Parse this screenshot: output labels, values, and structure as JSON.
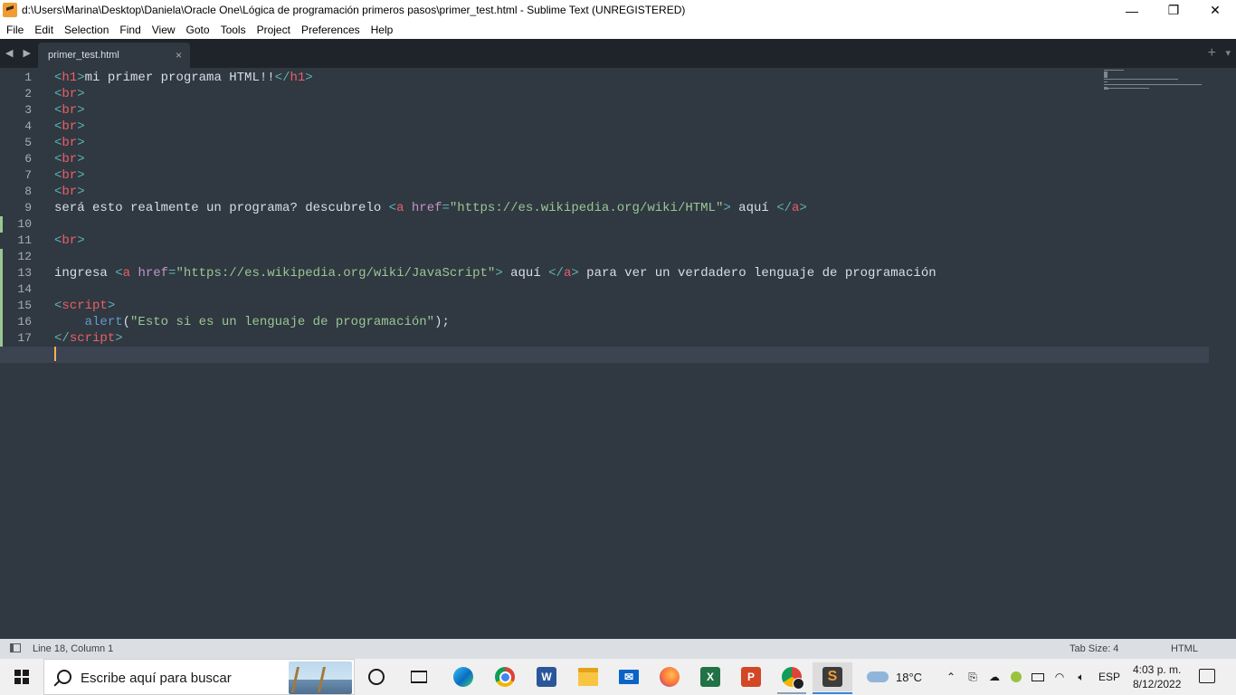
{
  "window": {
    "title": "d:\\Users\\Marina\\Desktop\\Daniela\\Oracle One\\Lógica de programación primeros pasos\\primer_test.html - Sublime Text (UNREGISTERED)",
    "minimize_glyph": "—",
    "maximize_glyph": "❐",
    "close_glyph": "✕"
  },
  "menu": [
    "File",
    "Edit",
    "Selection",
    "Find",
    "View",
    "Goto",
    "Tools",
    "Project",
    "Preferences",
    "Help"
  ],
  "tabs": {
    "nav_arrows": "◀ ▶",
    "active_tab": "primer_test.html",
    "close_glyph": "×",
    "add_glyph": "+",
    "more_glyph": "▾"
  },
  "editor": {
    "active_line": 18,
    "modified_lines": [
      10,
      12,
      13,
      14,
      15,
      16,
      17,
      18
    ],
    "lines": [
      [
        [
          "pn",
          "<"
        ],
        [
          "tg",
          "h1"
        ],
        [
          "pn",
          ">"
        ],
        [
          "tx",
          "mi primer programa HTML!!"
        ],
        [
          "pn",
          "</"
        ],
        [
          "tg",
          "h1"
        ],
        [
          "pn",
          ">"
        ]
      ],
      [
        [
          "pn",
          "<"
        ],
        [
          "tg",
          "br"
        ],
        [
          "pn",
          ">"
        ]
      ],
      [
        [
          "pn",
          "<"
        ],
        [
          "tg",
          "br"
        ],
        [
          "pn",
          ">"
        ]
      ],
      [
        [
          "pn",
          "<"
        ],
        [
          "tg",
          "br"
        ],
        [
          "pn",
          ">"
        ]
      ],
      [
        [
          "pn",
          "<"
        ],
        [
          "tg",
          "br"
        ],
        [
          "pn",
          ">"
        ]
      ],
      [
        [
          "pn",
          "<"
        ],
        [
          "tg",
          "br"
        ],
        [
          "pn",
          ">"
        ]
      ],
      [
        [
          "pn",
          "<"
        ],
        [
          "tg",
          "br"
        ],
        [
          "pn",
          ">"
        ]
      ],
      [
        [
          "pn",
          "<"
        ],
        [
          "tg",
          "br"
        ],
        [
          "pn",
          ">"
        ]
      ],
      [
        [
          "tx",
          "será esto realmente un programa? descubrelo "
        ],
        [
          "pn",
          "<"
        ],
        [
          "tg",
          "a"
        ],
        [
          "tx",
          " "
        ],
        [
          "at",
          "href"
        ],
        [
          "pn",
          "="
        ],
        [
          "st",
          "\"https://es.wikipedia.org/wiki/HTML\""
        ],
        [
          "pn",
          ">"
        ],
        [
          "tx",
          " aquí "
        ],
        [
          "pn",
          "</"
        ],
        [
          "tg",
          "a"
        ],
        [
          "pn",
          ">"
        ]
      ],
      [],
      [
        [
          "pn",
          "<"
        ],
        [
          "tg",
          "br"
        ],
        [
          "pn",
          ">"
        ]
      ],
      [],
      [
        [
          "tx",
          "ingresa "
        ],
        [
          "pn",
          "<"
        ],
        [
          "tg",
          "a"
        ],
        [
          "tx",
          " "
        ],
        [
          "at",
          "href"
        ],
        [
          "pn",
          "="
        ],
        [
          "st",
          "\"https://es.wikipedia.org/wiki/JavaScript\""
        ],
        [
          "pn",
          ">"
        ],
        [
          "tx",
          " aquí "
        ],
        [
          "pn",
          "</"
        ],
        [
          "tg",
          "a"
        ],
        [
          "pn",
          ">"
        ],
        [
          "tx",
          " para ver un verdadero lenguaje de programación"
        ]
      ],
      [],
      [
        [
          "pn",
          "<"
        ],
        [
          "tg",
          "script"
        ],
        [
          "pn",
          ">"
        ]
      ],
      [
        [
          "tx",
          "    "
        ],
        [
          "fn",
          "alert"
        ],
        [
          "tx",
          "("
        ],
        [
          "st",
          "\"Esto si es un lenguaje de programación\""
        ],
        [
          "tx",
          ");"
        ]
      ],
      [
        [
          "pn",
          "</"
        ],
        [
          "tg",
          "script"
        ],
        [
          "pn",
          ">"
        ]
      ],
      []
    ]
  },
  "status": {
    "position": "Line 18, Column 1",
    "tab_size": "Tab Size: 4",
    "syntax": "HTML"
  },
  "taskbar": {
    "search_placeholder": "Escribe aquí para buscar",
    "apps": [
      "cortana-icon",
      "task-view-icon",
      "edge-icon",
      "chrome-icon",
      "word-icon",
      "file-explorer-icon",
      "mail-icon",
      "firefox-icon",
      "excel-icon",
      "powerpoint-icon",
      "chrome-profile-icon",
      "sublime-text-icon"
    ],
    "weather": "18°C",
    "language": "ESP",
    "time": "4:03 p. m.",
    "date": "8/12/2022"
  },
  "colors": {
    "editor_bg": "#303841",
    "tag": "#ec5f67",
    "punctuation": "#5fb3b3",
    "attribute": "#c594c5",
    "string": "#99c794",
    "function": "#6699cc",
    "cursor": "#f9ae58"
  }
}
